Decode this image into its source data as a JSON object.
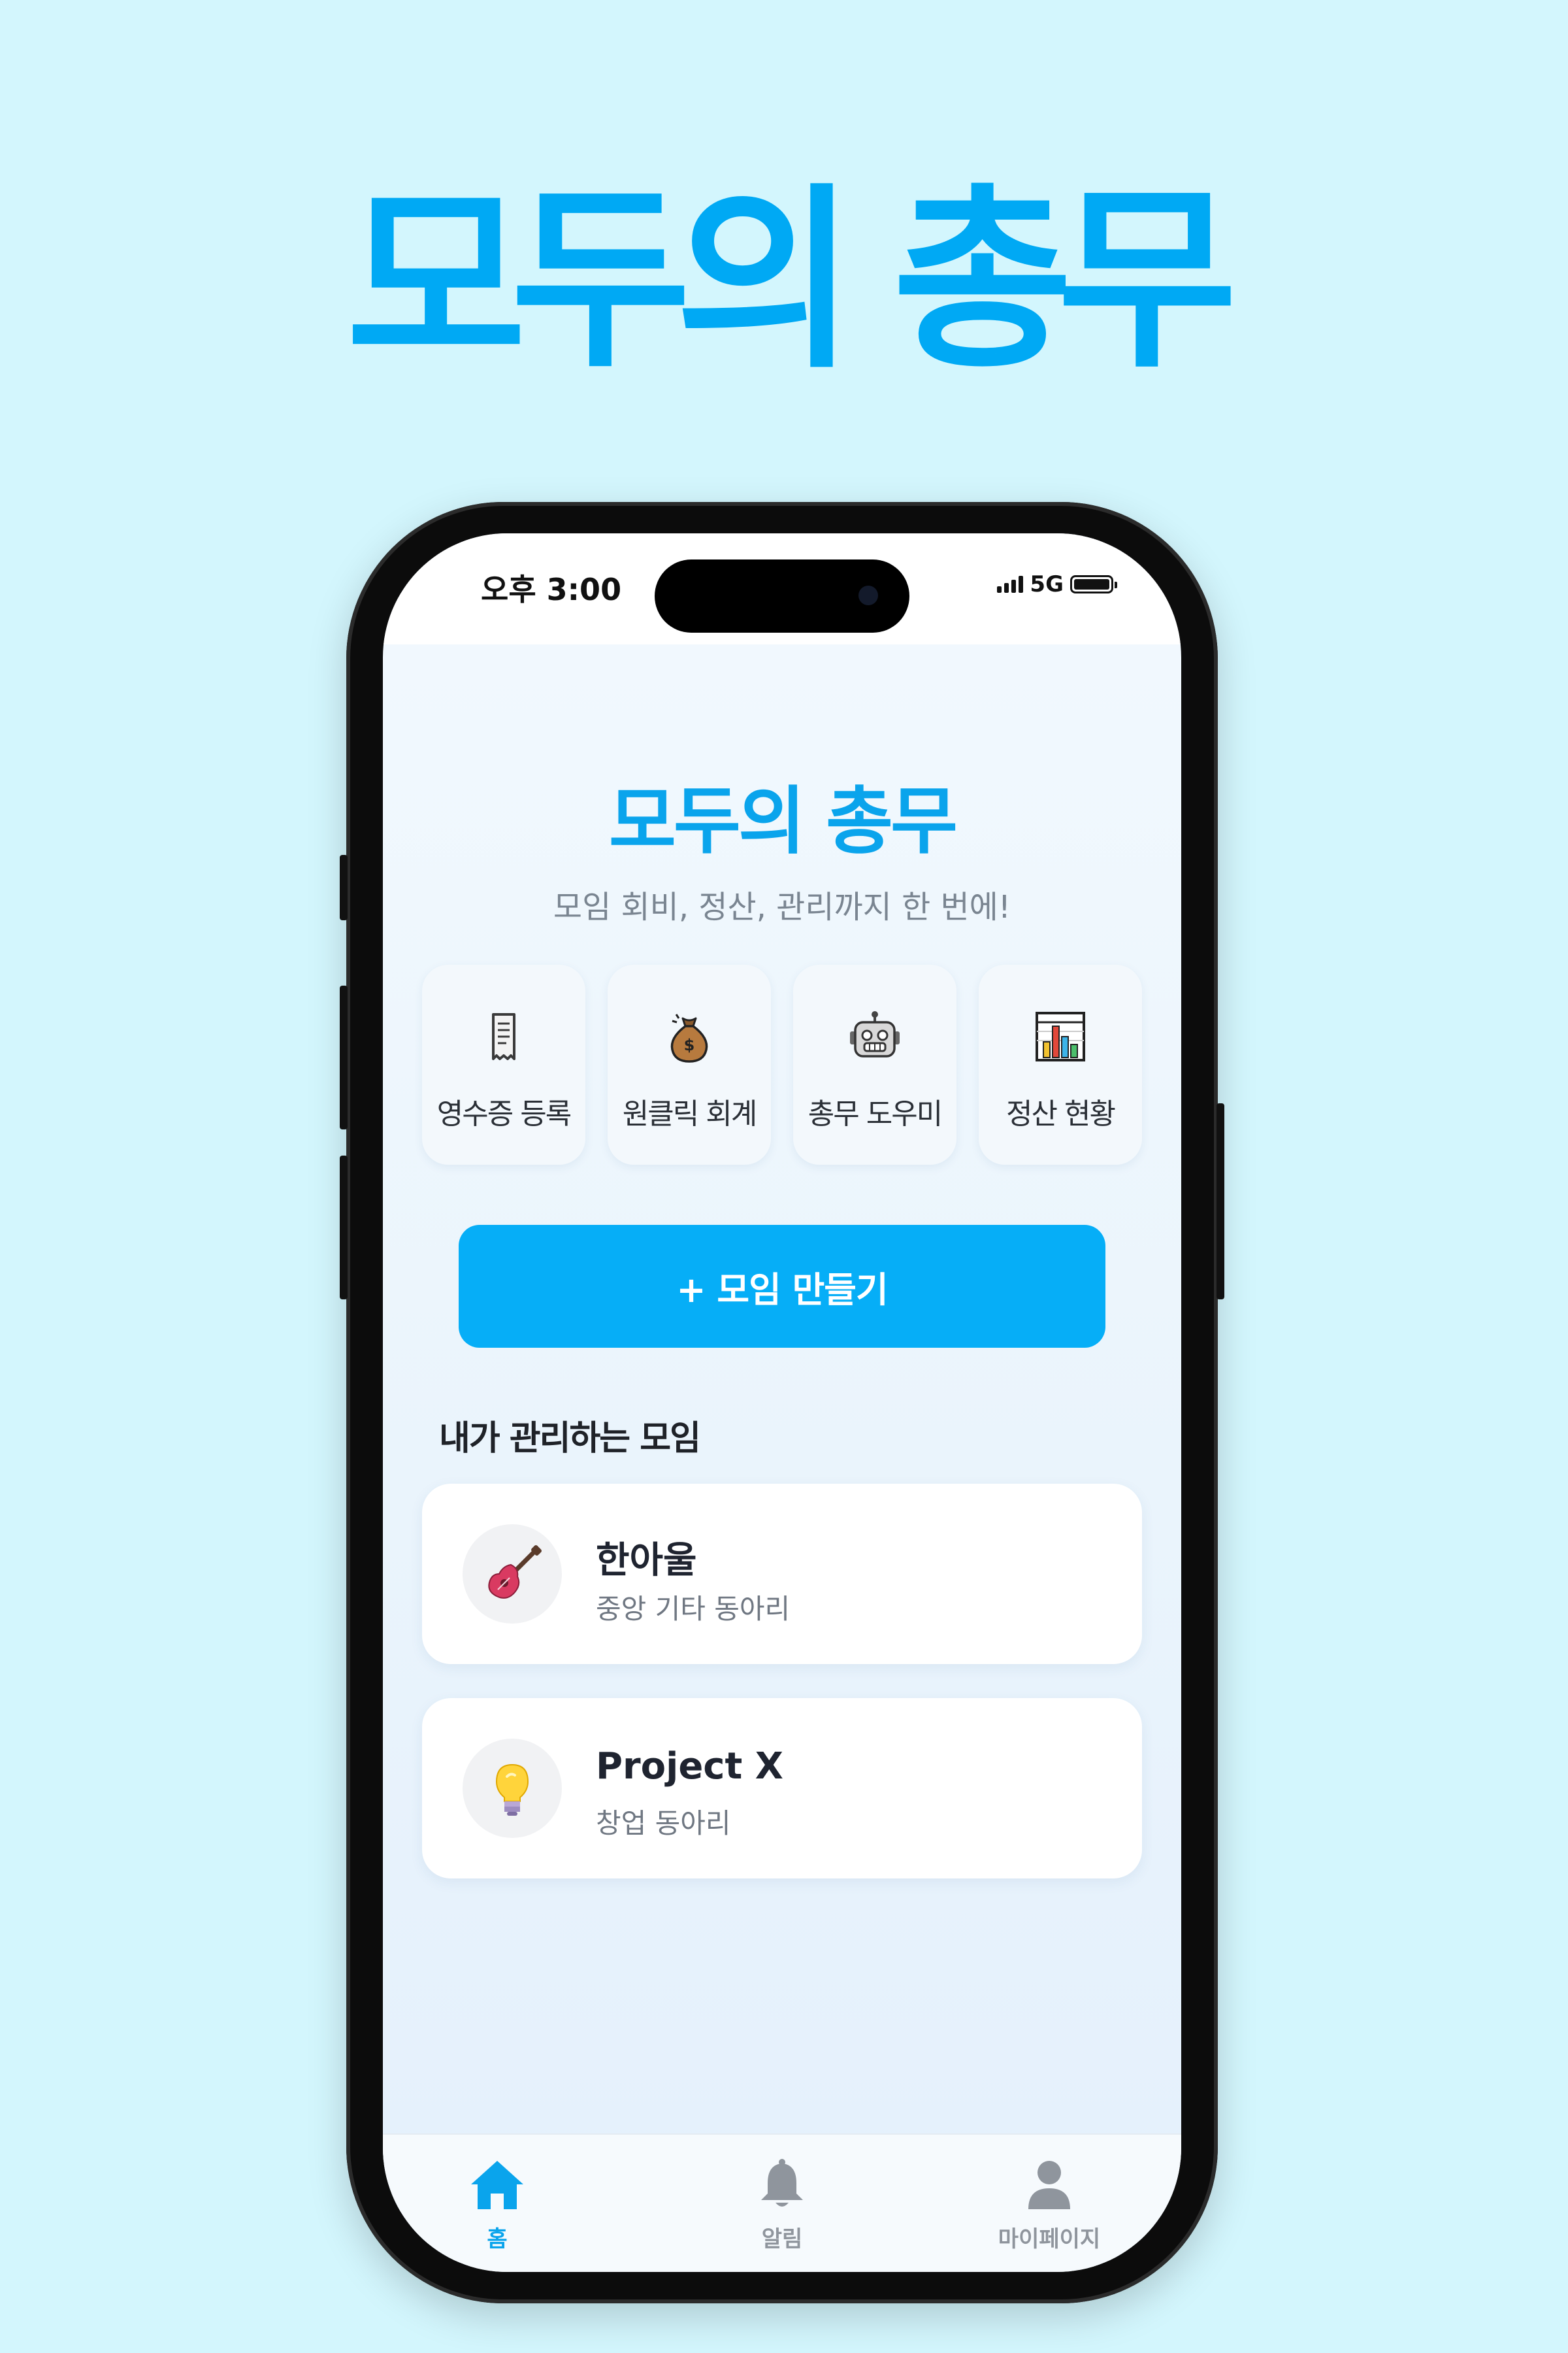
{
  "promo": {
    "title": "모두의 총무"
  },
  "status_bar": {
    "time": "오후 3:00",
    "network": "5G"
  },
  "header": {
    "title": "모두의 총무",
    "subtitle": "모임 회비, 정산, 관리까지 한 번에!"
  },
  "quick_actions": [
    {
      "label": "영수증 등록",
      "icon": "receipt-icon"
    },
    {
      "label": "원클릭 회계",
      "icon": "money-bag-icon"
    },
    {
      "label": "총무 도우미",
      "icon": "robot-icon"
    },
    {
      "label": "정산 현황",
      "icon": "bar-chart-icon"
    }
  ],
  "create_button": {
    "label": "+ 모임 만들기"
  },
  "groups_section": {
    "title": "내가 관리하는 모임",
    "groups": [
      {
        "name": "한아울",
        "description": "중앙 기타 동아리",
        "icon": "guitar-icon"
      },
      {
        "name": "Project X",
        "description": "창업 동아리",
        "icon": "lightbulb-icon"
      }
    ]
  },
  "bottom_nav": [
    {
      "label": "홈",
      "icon": "home-icon",
      "active": true
    },
    {
      "label": "알림",
      "icon": "bell-icon",
      "active": false
    },
    {
      "label": "마이페이지",
      "icon": "user-icon",
      "active": false
    }
  ],
  "colors": {
    "background": "#d3f6fd",
    "accent": "#00a9f4",
    "button": "#06aef7",
    "text_dark": "#1f2228",
    "text_muted": "#7a8591"
  }
}
